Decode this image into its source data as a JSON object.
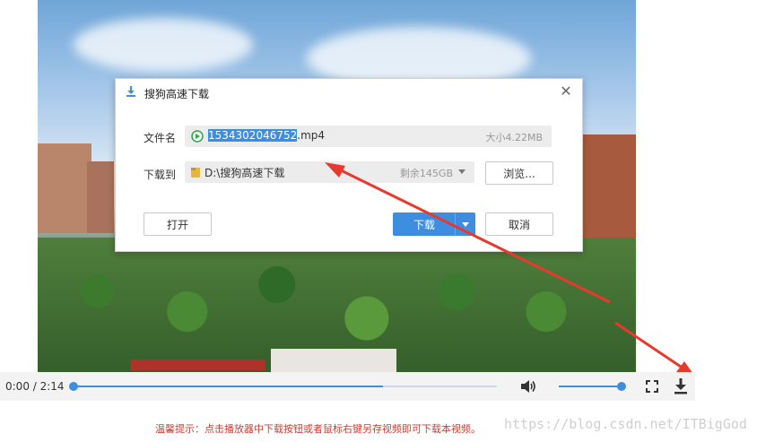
{
  "dialog": {
    "title": "搜狗高速下载",
    "filename_label": "文件名",
    "filename_selected": "1534302046752",
    "filename_ext": ".mp4",
    "file_size": "大小4.22MB",
    "saveto_label": "下载到",
    "save_path": "D:\\搜狗高速下载",
    "free_space": "剩余145GB",
    "browse_label": "浏览...",
    "open_label": "打开",
    "download_label": "下载",
    "cancel_label": "取消"
  },
  "player": {
    "time": "0:00 / 2:14",
    "progress": 0.0,
    "buffered": 0.73,
    "volume": 1.0
  },
  "hint": "温馨提示：点击播放器中下载按钮或者鼠标右键另存视频即可下载本视频。",
  "watermark": "https://blog.csdn.net/ITBigGod",
  "colors": {
    "accent": "#3d8ee0",
    "annotation_arrow": "#e8392e",
    "hint_text": "#d23a2e"
  }
}
